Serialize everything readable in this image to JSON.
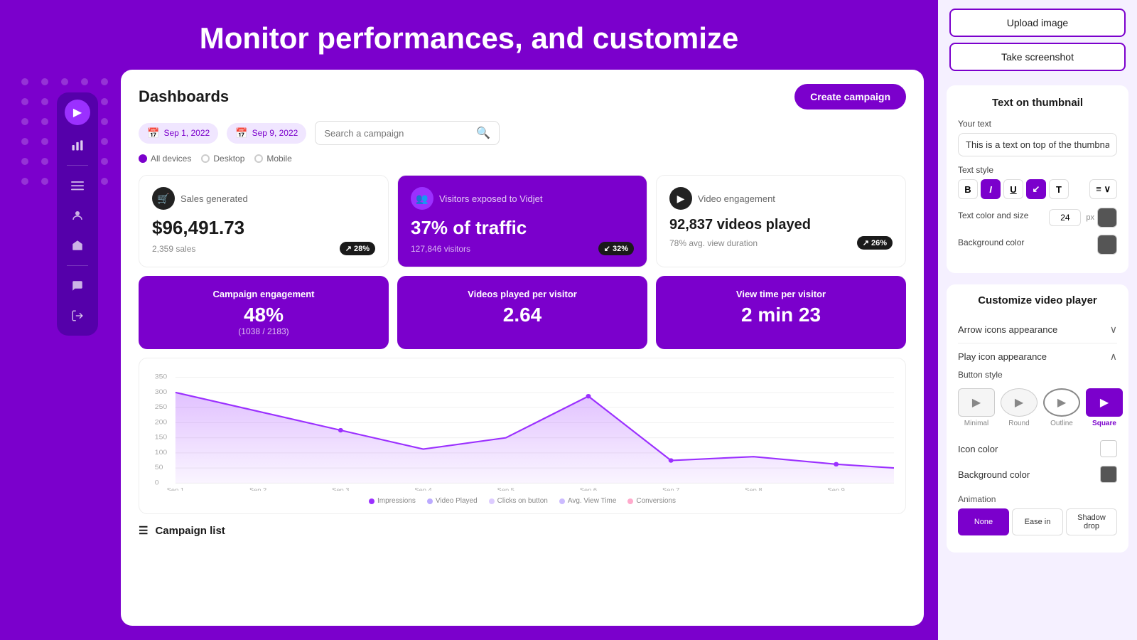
{
  "page": {
    "title": "Monitor performances, and customize"
  },
  "header_buttons": {
    "upload_image": "Upload image",
    "take_screenshot": "Take screenshot"
  },
  "dashboard": {
    "title": "Dashboards",
    "create_btn": "Create campaign",
    "date_from": "Sep 1, 2022",
    "date_to": "Sep 9, 2022",
    "search_placeholder": "Search a campaign",
    "devices": [
      "All devices",
      "Desktop",
      "Mobile"
    ],
    "stat_cards": [
      {
        "label": "Sales generated",
        "value": "$96,491.73",
        "sub": "2,359 sales",
        "badge": "↗ 28%",
        "icon": "🛒"
      },
      {
        "label": "Visitors exposed to Vidjet",
        "value": "37% of traffic",
        "sub": "127,846 visitors",
        "badge": "↙ 32%",
        "icon": "👥",
        "purple": true
      },
      {
        "label": "Video engagement",
        "value": "92,837 videos played",
        "sub": "78% avg. view duration",
        "badge": "↗ 26%",
        "icon": "▶"
      }
    ],
    "engagement_cards": [
      {
        "title": "Campaign engagement",
        "value": "48%",
        "sub": "(1038 / 2183)"
      },
      {
        "title": "Videos played per visitor",
        "value": "2.64",
        "sub": ""
      },
      {
        "title": "View time per visitor",
        "value": "2 min 23",
        "sub": ""
      }
    ],
    "chart": {
      "x_labels": [
        "Sep 1",
        "Sep 2",
        "Sep 3",
        "Sep 4",
        "Sep 5",
        "Sep 6",
        "Sep 7",
        "Sep 8",
        "Sep 9"
      ],
      "y_labels": [
        "350",
        "300",
        "250",
        "200",
        "150",
        "100",
        "50",
        "0"
      ],
      "legend": [
        {
          "label": "Impressions",
          "color": "#9B30FF"
        },
        {
          "label": "Video Played",
          "color": "#BBAAFF"
        },
        {
          "label": "Clicks on button",
          "color": "#DDCCFF"
        },
        {
          "label": "Avg. View Time",
          "color": "#CCBBFF"
        },
        {
          "label": "Conversions",
          "color": "#FFCCEE"
        }
      ]
    },
    "campaign_list_label": "Campaign list"
  },
  "right_panel": {
    "thumbnail": {
      "section_title": "Text on thumbnail",
      "your_text_label": "Your text",
      "your_text_value": "This is a text on top of the thumbna...",
      "text_style_label": "Text style",
      "text_color_size_label": "Text color and size",
      "size_value": "24",
      "px_label": "px",
      "bg_color_label": "Background color",
      "style_buttons": [
        {
          "label": "B",
          "active": false
        },
        {
          "label": "I",
          "active": true
        },
        {
          "label": "U",
          "active": false
        },
        {
          "label": "↙",
          "active": true
        },
        {
          "label": "T",
          "active": false
        }
      ]
    },
    "customize": {
      "section_title": "Customize video player",
      "arrow_icons_label": "Arrow icons appearance",
      "play_icon_label": "Play icon appearance",
      "button_style_label": "Button style",
      "button_styles": [
        {
          "label": "Minimal",
          "active": false
        },
        {
          "label": "Round",
          "active": false
        },
        {
          "label": "Outline",
          "active": false
        },
        {
          "label": "Square",
          "active": true
        }
      ],
      "icon_color_label": "Icon color",
      "bg_color_label": "Background color",
      "animation_label": "Animation",
      "animation_options": [
        {
          "label": "None",
          "active": true
        },
        {
          "label": "Ease in",
          "active": false
        },
        {
          "label": "Shadow drop",
          "active": false
        }
      ]
    }
  }
}
